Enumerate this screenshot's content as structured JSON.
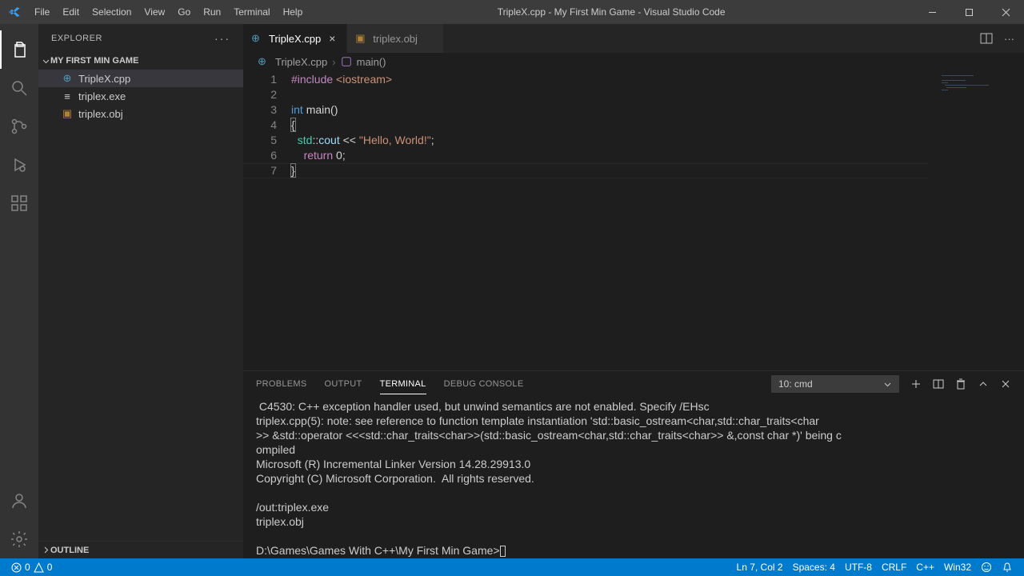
{
  "window": {
    "title": "TripleX.cpp - My First Min Game - Visual Studio Code"
  },
  "menu": [
    "File",
    "Edit",
    "Selection",
    "View",
    "Go",
    "Run",
    "Terminal",
    "Help"
  ],
  "explorer": {
    "title": "EXPLORER",
    "workspace": "MY FIRST MIN GAME",
    "files": [
      {
        "name": "TripleX.cpp",
        "icon": "cpp",
        "active": true
      },
      {
        "name": "triplex.exe",
        "icon": "exe",
        "active": false
      },
      {
        "name": "triplex.obj",
        "icon": "obj",
        "active": false
      }
    ],
    "outline": "OUTLINE"
  },
  "tabs": [
    {
      "label": "TripleX.cpp",
      "icon": "cpp",
      "active": true,
      "close": true
    },
    {
      "label": "triplex.obj",
      "icon": "obj",
      "active": false,
      "close": false
    }
  ],
  "breadcrumb": {
    "file": "TripleX.cpp",
    "symbol": "main()"
  },
  "code": {
    "lines": [
      "1",
      "2",
      "3",
      "4",
      "5",
      "6",
      "7"
    ],
    "l1_include": "#include",
    "l1_hdr": "<iostream>",
    "l3_int": "int",
    "l3_main": "main()",
    "l4": "{",
    "l5_ns": "std",
    "l5_sep": "::",
    "l5_cout": "cout",
    "l5_op": " << ",
    "l5_str": "\"Hello, World!\"",
    "l5_semi": ";",
    "l6_ret": "return",
    "l6_val": " 0;",
    "l7": "}"
  },
  "panel": {
    "tabs": [
      "PROBLEMS",
      "OUTPUT",
      "TERMINAL",
      "DEBUG CONSOLE"
    ],
    "activeTab": "TERMINAL",
    "dropdown": "10: cmd",
    "body": " C4530: C++ exception handler used, but unwind semantics are not enabled. Specify /EHsc\ntriplex.cpp(5): note: see reference to function template instantiation 'std::basic_ostream<char,std::char_traits<char\n>> &std::operator <<<std::char_traits<char>>(std::basic_ostream<char,std::char_traits<char>> &,const char *)' being c\nompiled\nMicrosoft (R) Incremental Linker Version 14.28.29913.0\nCopyright (C) Microsoft Corporation.  All rights reserved.\n\n/out:triplex.exe\ntriplex.obj\n\nD:\\Games\\Games With C++\\My First Min Game>"
  },
  "status": {
    "errors": "0",
    "warnings": "0",
    "ln": "Ln 7, Col 2",
    "spaces": "Spaces: 4",
    "enc": "UTF-8",
    "eol": "CRLF",
    "lang": "C++",
    "target": "Win32"
  }
}
